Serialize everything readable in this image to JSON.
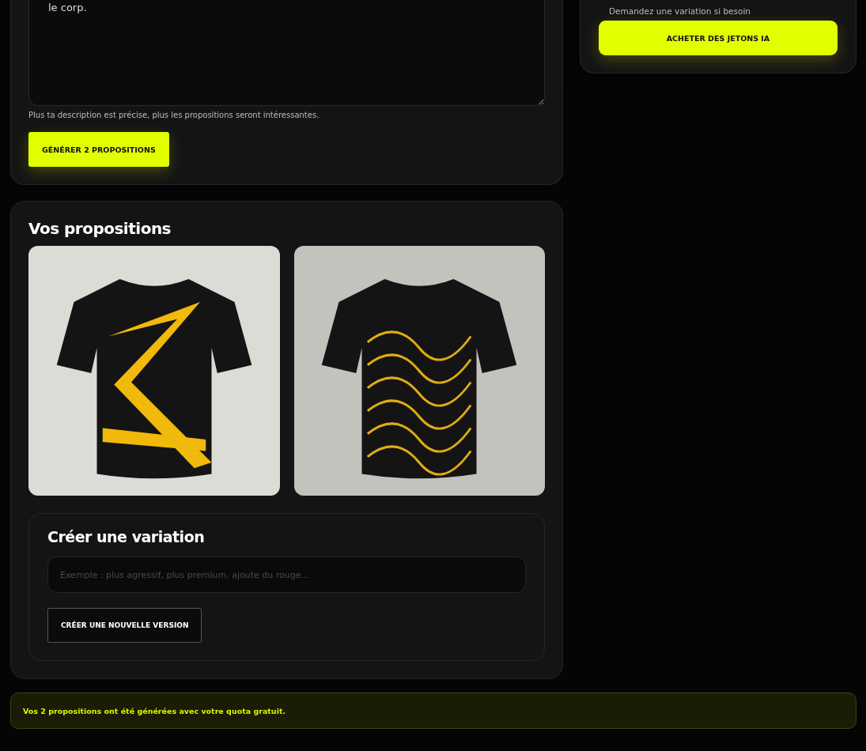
{
  "brief": {
    "description_value": "le corp.",
    "hint": "Plus ta description est précise, plus les propositions seront intéressantes.",
    "generate_button": "GÉNÉRER 2 PROPOSITIONS"
  },
  "tokens": {
    "note": "Demandez une variation si besoin",
    "buy_button": "ACHETER DES JETONS IA"
  },
  "proposals": {
    "title": "Vos propositions",
    "images": [
      {
        "kind": "bold-stripes"
      },
      {
        "kind": "wavy-lines"
      }
    ]
  },
  "variation": {
    "title": "Créer une variation",
    "placeholder": "Exemple : plus agressif, plus premium, ajoute du rouge...",
    "button": "CRÉER UNE NOUVELLE VERSION"
  },
  "notice": "Vos 2 propositions ont été générées avec votre quota gratuit."
}
